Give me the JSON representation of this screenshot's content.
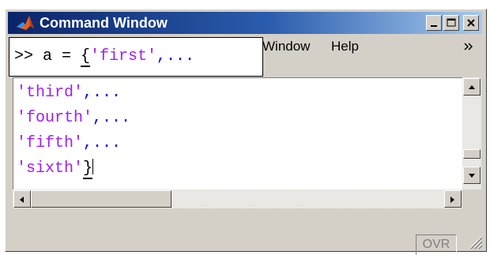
{
  "window": {
    "title": "Command Window",
    "buttons": {
      "minimize": "_",
      "maximize": "□",
      "close": "×"
    }
  },
  "menubar": {
    "items": [
      {
        "label": "Window"
      },
      {
        "label": "Help"
      }
    ],
    "overflow_icon": "chevron-double-right-icon"
  },
  "tooltip": {
    "prompt": ">> a = ",
    "paren": "{",
    "string": "'first'",
    "continuation": ",..."
  },
  "editor": {
    "lines": [
      {
        "string": "'third'",
        "continuation": ",..."
      },
      {
        "string": "'fourth'",
        "continuation": ",..."
      },
      {
        "string": "'fifth'",
        "continuation": ",..."
      },
      {
        "string": "'sixth'",
        "closing": "}"
      }
    ]
  },
  "statusbar": {
    "mode": "OVR"
  },
  "colors": {
    "string": "#a020f0",
    "continuation": "#0000ff",
    "title_gradient_start": "#0a246a",
    "title_gradient_end": "#a6caf0"
  }
}
